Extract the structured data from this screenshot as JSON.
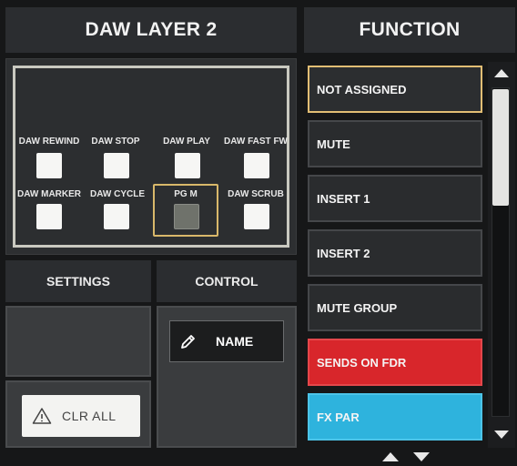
{
  "header": {
    "layer_title": "DAW LAYER 2",
    "function_title": "FUNCTION"
  },
  "daw_buttons": {
    "row1": [
      "DAW REWIND",
      "DAW STOP",
      "DAW PLAY",
      "DAW FAST FW"
    ],
    "row2": [
      "DAW MARKER",
      "DAW CYCLE",
      "PG M",
      "DAW SCRUB"
    ],
    "selected": "PG M"
  },
  "settings": {
    "label": "SETTINGS"
  },
  "control": {
    "label": "CONTROL"
  },
  "name_button": {
    "label": "NAME",
    "icon": "pencil-icon"
  },
  "clr_button": {
    "label": "CLR ALL",
    "icon": "warning-icon"
  },
  "function_list": [
    {
      "label": "NOT ASSIGNED",
      "state": "selected"
    },
    {
      "label": "MUTE"
    },
    {
      "label": "INSERT 1"
    },
    {
      "label": "INSERT 2"
    },
    {
      "label": "MUTE GROUP"
    },
    {
      "label": "SENDS ON FDR",
      "color": "#d8262b"
    },
    {
      "label": "FX PAR",
      "color": "#2eb3dd"
    }
  ],
  "colors": {
    "accent": "#e2be74",
    "selected_outline": "#d9b86a",
    "sends_on_fdr": "#d8262b",
    "fx_par": "#2eb3dd"
  }
}
